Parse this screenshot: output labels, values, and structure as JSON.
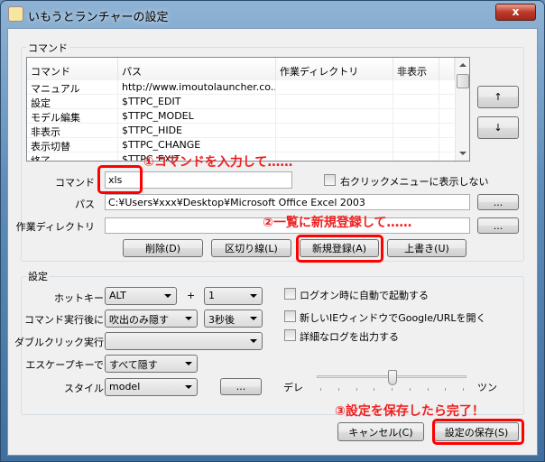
{
  "window": {
    "title": "いもうとランチャーの設定",
    "close_label": "x"
  },
  "command_group": {
    "label": "コマンド",
    "columns": [
      "コマンド",
      "パス",
      "作業ディレクトリ",
      "非表示"
    ],
    "rows": [
      [
        "マニュアル",
        "http://www.imoutolauncher.co...",
        "",
        ""
      ],
      [
        "設定",
        "$TTPC_EDIT",
        "",
        ""
      ],
      [
        "モデル編集",
        "$TTPC_MODEL",
        "",
        ""
      ],
      [
        "非表示",
        "$TTPC_HIDE",
        "",
        ""
      ],
      [
        "表示切替",
        "$TTPC_CHANGE",
        "",
        ""
      ],
      [
        "終了",
        "$TTPC_EXIT",
        "",
        ""
      ]
    ],
    "up_label": "↑",
    "down_label": "↓",
    "command_label": "コマンド",
    "command_value": "xls",
    "hide_context_label": "右クリックメニューに表示しない",
    "path_label": "パス",
    "path_value": "C:¥Users¥xxx¥Desktop¥Microsoft Office Excel 2003",
    "workdir_label": "作業ディレクトリ",
    "workdir_value": "",
    "browse_label": "...",
    "delete_label": "削除(D)",
    "separator_label": "区切り線(L)",
    "add_label": "新規登録(A)",
    "overwrite_label": "上書き(U)"
  },
  "settings_group": {
    "label": "設定",
    "hotkey_label": "ホットキー",
    "hotkey_mod": "ALT",
    "plus": "+",
    "hotkey_key": "1",
    "after_exec_label": "コマンド実行後に",
    "after_exec_value": "吹出のみ隠す",
    "after_exec_delay": "3秒後",
    "dblclick_label": "ダブルクリック実行",
    "dblclick_value": "",
    "escape_label": "エスケープキーで",
    "escape_value": "すべて隠す",
    "style_label": "スタイル",
    "style_value": "model",
    "style_browse": "...",
    "checkboxes": [
      {
        "label": "ログオン時に自動で起動する",
        "checked": false
      },
      {
        "label": "新しいIEウィンドウでGoogle/URLを開く",
        "checked": false
      },
      {
        "label": "詳細なログを出力する",
        "checked": false
      }
    ],
    "slider": {
      "left_label": "デレ",
      "right_label": "ツン",
      "value": 0.5
    }
  },
  "footer": {
    "cancel_label": "キャンセル(C)",
    "save_label": "設定の保存(S)"
  },
  "annotations": {
    "step1": "①コマンドを入力して……",
    "step2": "②一覧に新規登録して……",
    "step3": "③設定を保存したら完了！",
    "color": "#f02020"
  }
}
